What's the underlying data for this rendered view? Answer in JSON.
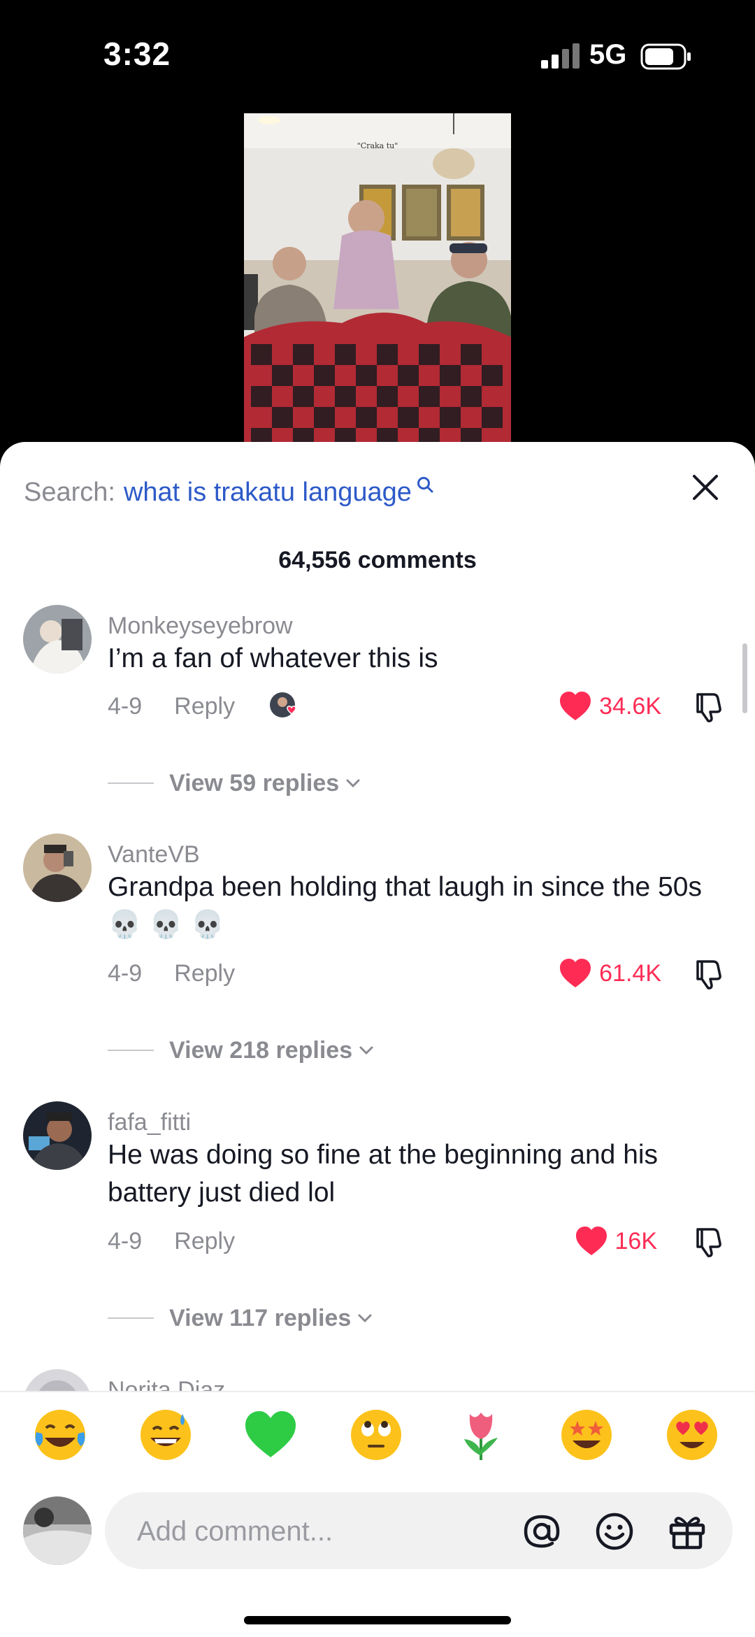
{
  "status_bar": {
    "time": "3:32",
    "network": "5G"
  },
  "video": {
    "caption": "\"Craka tu\""
  },
  "search": {
    "prefix": "Search:",
    "term": "what is trakatu language"
  },
  "comments_count": "64,556 comments",
  "comments": [
    {
      "username": "Monkeyseyebrow",
      "text": "I’m a fan of whatever this is",
      "date": "4-9",
      "reply": "Reply",
      "likes": "34.6K",
      "view_replies": "View 59 replies",
      "creator_liked": true
    },
    {
      "username": "VanteVB",
      "text": "Grandpa been holding that laugh in since the 50s 💀 💀 💀",
      "date": "4-9",
      "reply": "Reply",
      "likes": "61.4K",
      "view_replies": "View 218 replies"
    },
    {
      "username": "fafa_fitti",
      "text": "He was doing so fine at the beginning and his battery just died lol",
      "date": "4-9",
      "reply": "Reply",
      "likes": "16K",
      "view_replies": "View 117 replies"
    },
    {
      "username": "Norita Diaz"
    }
  ],
  "emoji_bar": [
    "😂",
    "😅",
    "💚",
    "🙄",
    "🌷",
    "🤩",
    "😍"
  ],
  "input": {
    "placeholder": "Add comment..."
  },
  "colors": {
    "accent_like": "#fe2c55",
    "search_term": "#2d5ac8"
  }
}
